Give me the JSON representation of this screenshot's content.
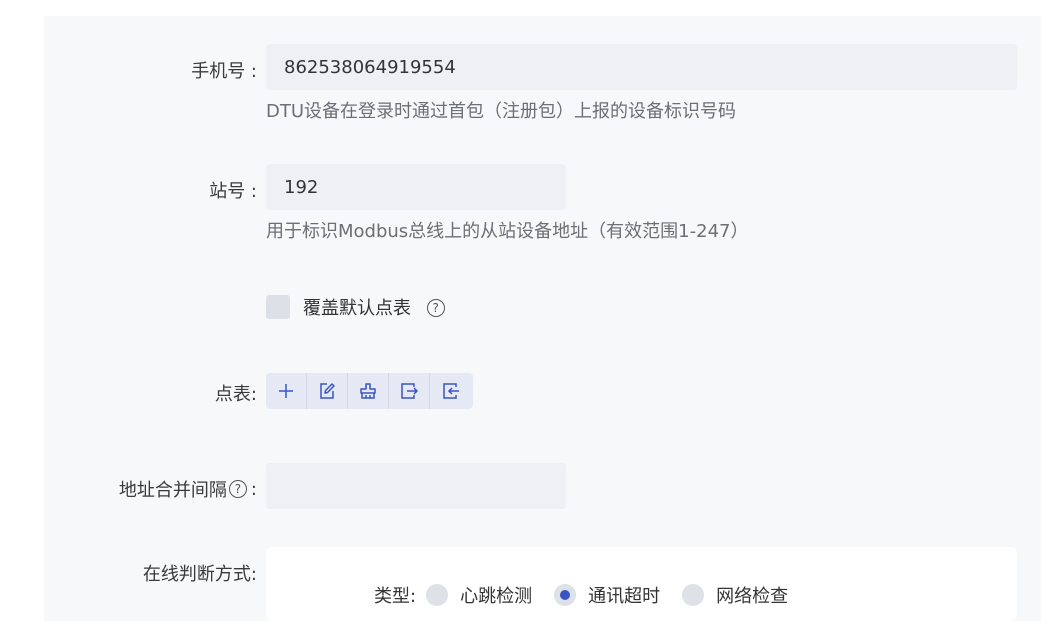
{
  "fields": {
    "phone": {
      "label": "手机号 :",
      "value": "862538064919554",
      "hint": "DTU设备在登录时通过首包（注册包）上报的设备标识号码"
    },
    "station": {
      "label": "站号 :",
      "value": "192",
      "hint": "用于标识Modbus总线上的从站设备地址（有效范围1-247）"
    },
    "override": {
      "label": "覆盖默认点表",
      "checked": false,
      "help_icon": "question-circle-icon"
    },
    "point_table": {
      "label": "点表:",
      "tools": [
        {
          "icon": "plus-icon"
        },
        {
          "icon": "edit-icon"
        },
        {
          "icon": "clear-icon"
        },
        {
          "icon": "export-icon"
        },
        {
          "icon": "import-icon"
        }
      ]
    },
    "merge_interval": {
      "label": "地址合并间隔",
      "colon": ":",
      "value": "",
      "help_icon": "question-circle-icon"
    },
    "online_mode": {
      "label": "在线判断方式:",
      "type_label": "类型:",
      "options": [
        {
          "label": "心跳检测",
          "checked": false
        },
        {
          "label": "通讯超时",
          "checked": true
        },
        {
          "label": "网络检查",
          "checked": false
        }
      ]
    }
  },
  "colors": {
    "accent": "#3b54c4",
    "input_bg": "#eef0f3",
    "panel_bg": "#f7f8fa"
  }
}
